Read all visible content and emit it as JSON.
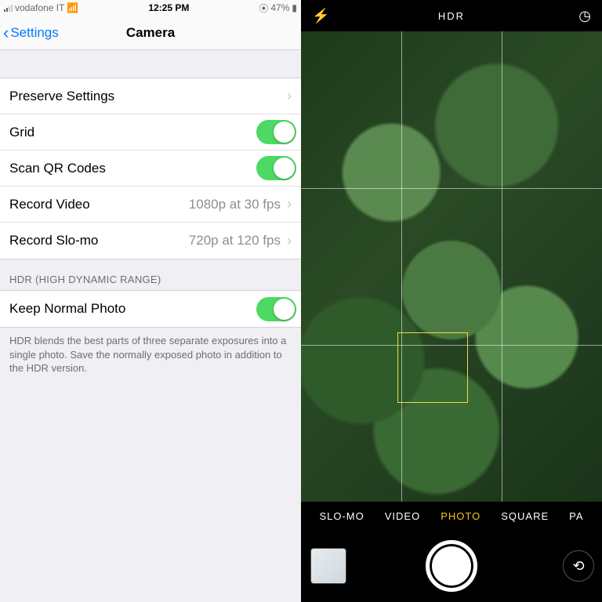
{
  "left": {
    "statusbar": {
      "carrier": "vodafone IT",
      "time": "12:25 PM",
      "battery": "47%"
    },
    "nav": {
      "back": "Settings",
      "title": "Camera"
    },
    "rows": {
      "preserve": "Preserve Settings",
      "grid": "Grid",
      "qr": "Scan QR Codes",
      "record_video": {
        "label": "Record Video",
        "value": "1080p at 30 fps"
      },
      "record_slomo": {
        "label": "Record Slo-mo",
        "value": "720p at 120 fps"
      }
    },
    "section_header": "HDR (HIGH DYNAMIC RANGE)",
    "keep_normal": "Keep Normal Photo",
    "footer": "HDR blends the best parts of three separate exposures into a single photo. Save the normally exposed photo in addition to the HDR version."
  },
  "right": {
    "top": {
      "hdr": "HDR"
    },
    "modes": {
      "slomo": "SLO-MO",
      "video": "VIDEO",
      "photo": "PHOTO",
      "square": "SQUARE",
      "pano": "PA"
    }
  }
}
